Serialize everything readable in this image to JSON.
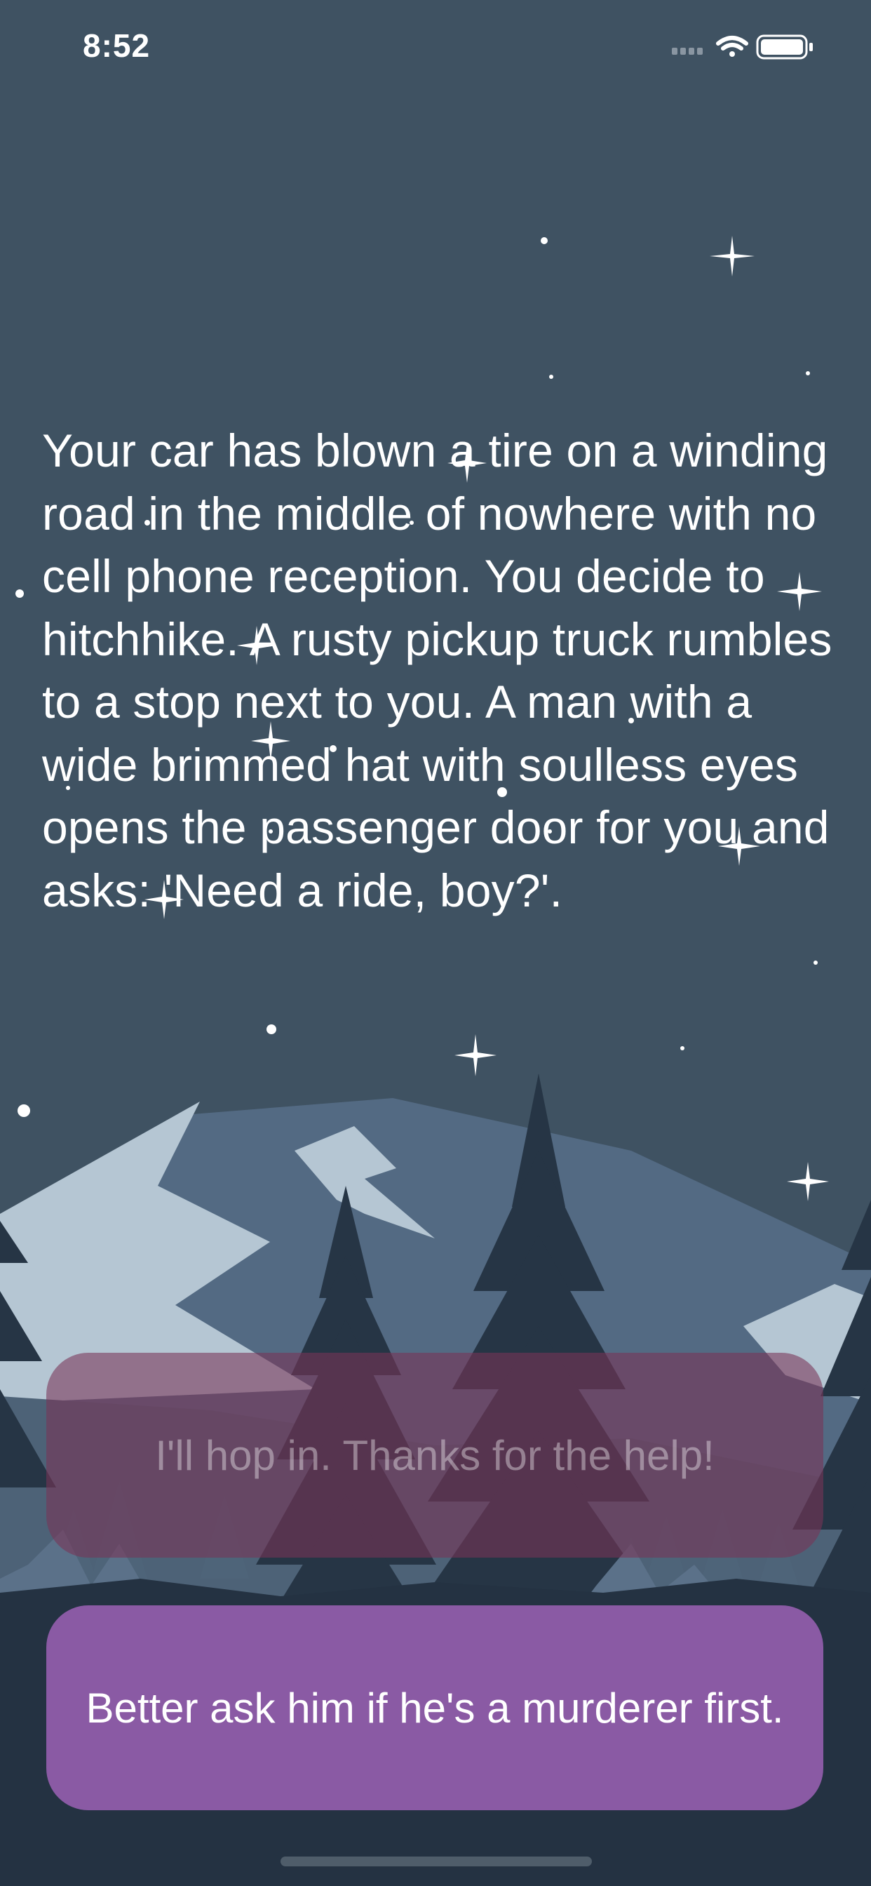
{
  "status_bar": {
    "time": "8:52",
    "signal_icon": "cellular-signal-icon",
    "wifi_icon": "wifi-icon",
    "battery_icon": "battery-icon"
  },
  "story": {
    "text": "Your car has blown a tire on a winding road in the middle of nowhere with no cell phone reception. You decide to hitchhike. A rusty pickup truck rumbles to a stop next to you. A man with a wide brimmed hat with soulless eyes opens the passenger door for you and asks: 'Need a ride, boy?'."
  },
  "choices": [
    {
      "label": "I'll hop in. Thanks for the help!"
    },
    {
      "label": "Better ask him if he's a murderer first."
    }
  ],
  "colors": {
    "sky": "#3f5262",
    "choice_primary": "#8a5aa4",
    "choice_secondary": "#783456"
  }
}
